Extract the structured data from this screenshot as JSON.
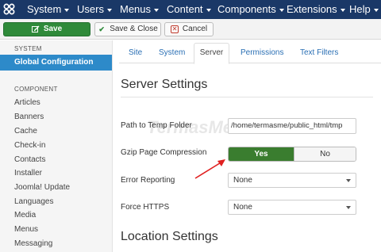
{
  "navbar": {
    "logo_icon": "joomla-logo-icon",
    "menus": [
      {
        "label": "System"
      },
      {
        "label": "Users"
      },
      {
        "label": "Menus"
      },
      {
        "label": "Content"
      },
      {
        "label": "Components"
      },
      {
        "label": "Extensions"
      },
      {
        "label": "Help"
      }
    ]
  },
  "toolbar": {
    "save_label": "Save",
    "save_close_label": "Save & Close",
    "cancel_label": "Cancel",
    "save_color": "#2f8a3a"
  },
  "sidebar": {
    "system_heading": "SYSTEM",
    "active_item": "Global Configuration",
    "component_heading": "COMPONENT",
    "items": [
      {
        "label": "Articles"
      },
      {
        "label": "Banners"
      },
      {
        "label": "Cache"
      },
      {
        "label": "Check-in"
      },
      {
        "label": "Contacts"
      },
      {
        "label": "Installer"
      },
      {
        "label": "Joomla! Update"
      },
      {
        "label": "Languages"
      },
      {
        "label": "Media"
      },
      {
        "label": "Menus"
      },
      {
        "label": "Messaging"
      }
    ]
  },
  "tabs": {
    "site": "Site",
    "system": "System",
    "server": "Server",
    "permissions": "Permissions",
    "text_filters": "Text Filters",
    "active": "Server"
  },
  "server_settings": {
    "heading": "Server Settings",
    "temp_folder_label": "Path to Temp Folder",
    "temp_folder_value": "/home/termasme/public_html/tmp",
    "gzip_label": "Gzip Page Compression",
    "gzip_yes": "Yes",
    "gzip_no": "No",
    "gzip_selected": "Yes",
    "error_reporting_label": "Error Reporting",
    "error_reporting_value": "None",
    "force_https_label": "Force HTTPS",
    "force_https_value": "None"
  },
  "location_settings": {
    "heading": "Location Settings"
  },
  "watermark": "TermasMedia",
  "colors": {
    "navbar": "#1a3867",
    "sidebar_active": "#2d8ac9",
    "toggle_yes": "#3a7d2f",
    "annotation_arrow": "#e02020"
  }
}
